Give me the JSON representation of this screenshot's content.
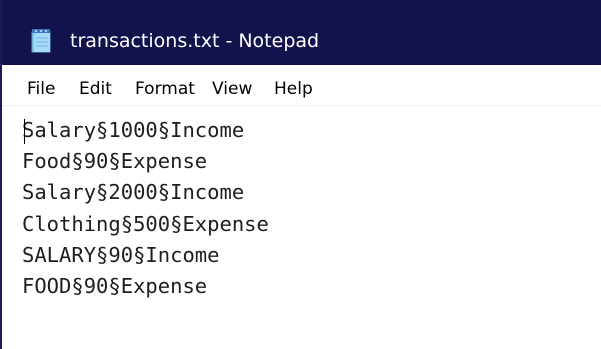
{
  "window": {
    "title": "transactions.txt - Notepad",
    "titlebar_color": "#12134c",
    "app_icon": "notepad-icon"
  },
  "menu": {
    "items": [
      {
        "label": "File"
      },
      {
        "label": "Edit"
      },
      {
        "label": "Format"
      },
      {
        "label": "View"
      },
      {
        "label": "Help"
      }
    ]
  },
  "document": {
    "lines": [
      "Salary§1000§Income",
      "Food§90§Expense",
      "Salary§2000§Income",
      "Clothing§500§Expense",
      "SALARY§90§Income",
      "FOOD§90§Expense"
    ]
  }
}
